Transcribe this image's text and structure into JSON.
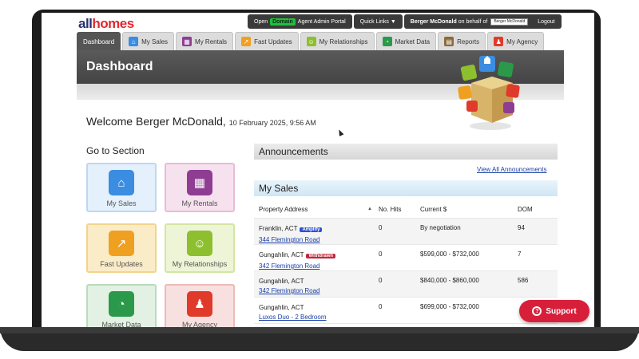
{
  "header": {
    "logo_main": "all",
    "logo_accent": "homes",
    "open_prefix": "Open",
    "domain_label": "Domain",
    "portal_label": "Agent Admin Portal",
    "quick_links": "Quick Links ▼",
    "logged_user": "Berger McDonald",
    "behalf_text": "on behalf of",
    "behalf_select": "Berger McDonald",
    "logout": "Logout"
  },
  "tabs": [
    {
      "label": "Dashboard",
      "icon": "dashboard-icon",
      "color": "#555555"
    },
    {
      "label": "My Sales",
      "icon": "house-icon",
      "color": "#3a8de0"
    },
    {
      "label": "My Rentals",
      "icon": "building-icon",
      "color": "#8e3d92"
    },
    {
      "label": "Fast Updates",
      "icon": "arrow-up-icon",
      "color": "#f0a020"
    },
    {
      "label": "My Relationships",
      "icon": "people-icon",
      "color": "#8dbf2f"
    },
    {
      "label": "Market Data",
      "icon": "pie-chart-icon",
      "color": "#2a9a4a"
    },
    {
      "label": "Reports",
      "icon": "report-icon",
      "color": "#8a6a3a"
    },
    {
      "label": "My Agency",
      "icon": "agent-icon",
      "color": "#e03a2a"
    }
  ],
  "banner": {
    "title": "Dashboard"
  },
  "welcome": {
    "text": "Welcome Berger McDonald,",
    "date": "10 February 2025, 9:56 AM"
  },
  "goto": {
    "title": "Go to Section",
    "tiles": [
      {
        "label": "My Sales",
        "icon": "house-icon",
        "bg": "#e4f0fb",
        "border": "#bcd8f2",
        "color": "#3a8de0"
      },
      {
        "label": "My Rentals",
        "icon": "building-icon",
        "bg": "#f6e1ee",
        "border": "#e8bcd6",
        "color": "#8e3d92"
      },
      {
        "label": "Fast Updates",
        "icon": "arrow-up-icon",
        "bg": "#fbecc8",
        "border": "#f2d48a",
        "color": "#f0a020"
      },
      {
        "label": "My Relationships",
        "icon": "people-icon",
        "bg": "#eef5d6",
        "border": "#d2e6a0",
        "color": "#8dbf2f"
      },
      {
        "label": "Market Data",
        "icon": "pie-chart-icon",
        "bg": "#e2f1e4",
        "border": "#b8dcbc",
        "color": "#2a9a4a"
      },
      {
        "label": "My Agency",
        "icon": "agent-icon",
        "bg": "#f8e0e0",
        "border": "#ecbaba",
        "color": "#e03a2a"
      }
    ]
  },
  "announcements": {
    "title": "Announcements",
    "view_all": "View All Announcements"
  },
  "my_sales": {
    "title": "My Sales",
    "columns": {
      "address": "Property Address",
      "hits": "No. Hits",
      "price": "Current $",
      "dom": "DOM"
    },
    "rows": [
      {
        "suburb": "Franklin, ACT",
        "badge": "Amplify",
        "badge_color": "#2d4fd4",
        "address": "344 Flemington Road",
        "hits": "0",
        "price": "By negotiation",
        "dom": "94"
      },
      {
        "suburb": "Gungahlin, ACT",
        "badge": "Withdrawn",
        "badge_color": "#c0283a",
        "address": "342 Flemington Road",
        "hits": "0",
        "price": "$599,000 - $732,000",
        "dom": "7"
      },
      {
        "suburb": "Gungahlin, ACT",
        "badge": "",
        "badge_color": "",
        "address": "342 Flemington Road",
        "hits": "0",
        "price": "$840,000 - $860,000",
        "dom": "586"
      },
      {
        "suburb": "Gungahlin, ACT",
        "badge": "",
        "badge_color": "",
        "address": "Luxos Duo - 2 Bedroom",
        "hits": "0",
        "price": "$699,000 - $732,000",
        "dom": ""
      }
    ]
  },
  "support": {
    "label": "Support",
    "icon": "question-icon"
  }
}
